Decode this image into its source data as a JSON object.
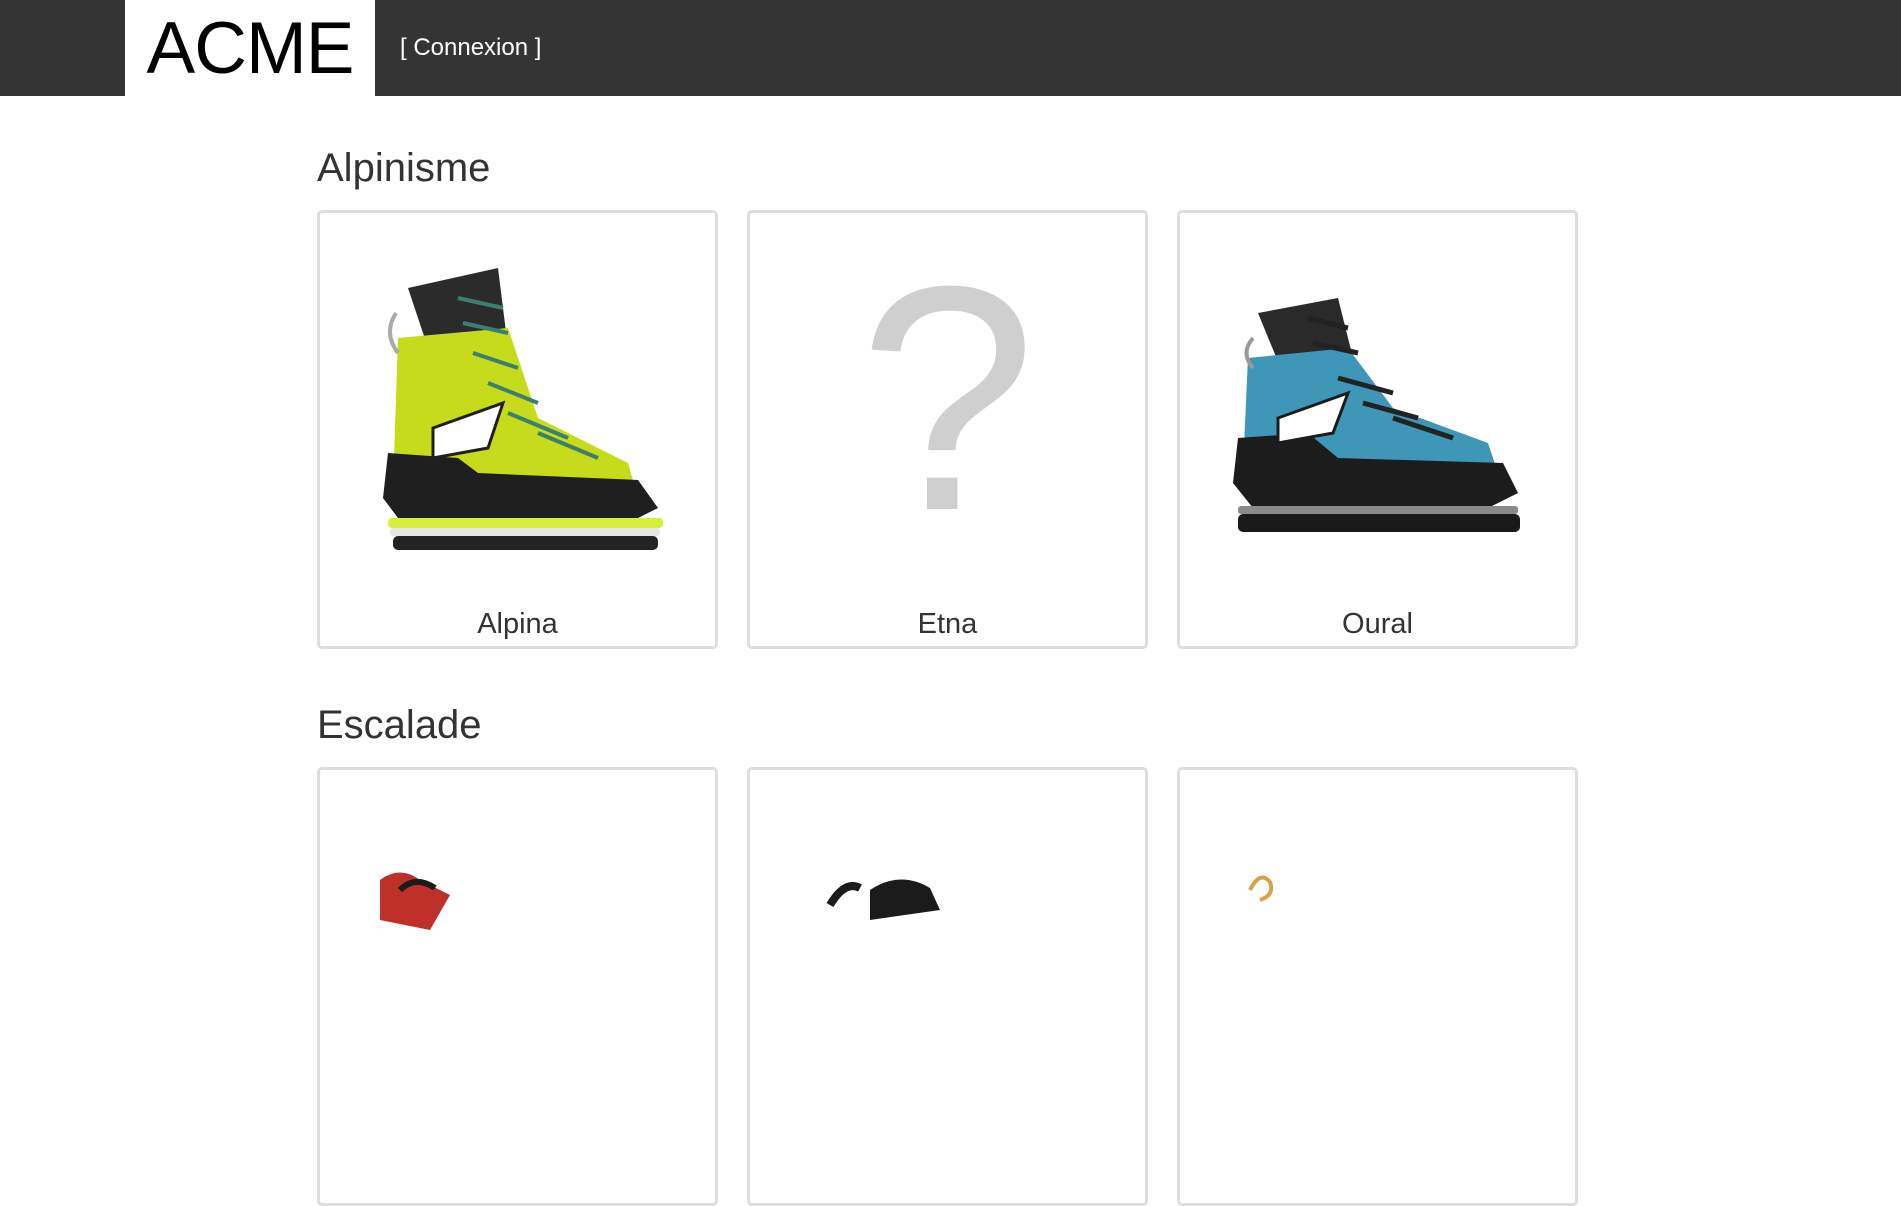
{
  "header": {
    "logo_text": "ACME",
    "login_label": "[ Connexion ]"
  },
  "sections": [
    {
      "title": "Alpinisme",
      "products": [
        {
          "name": "Alpina",
          "image": "lime-green-mountaineering-boot"
        },
        {
          "name": "Etna",
          "image": "question-mark-placeholder",
          "placeholder_glyph": "?"
        },
        {
          "name": "Oural",
          "image": "blue-black-mountaineering-boot"
        }
      ]
    },
    {
      "title": "Escalade",
      "products": [
        {
          "name": "",
          "image": "red-climbing-shoe"
        },
        {
          "name": "",
          "image": "black-climbing-shoe"
        },
        {
          "name": "",
          "image": "tan-climbing-shoe"
        }
      ]
    }
  ],
  "colors": {
    "header_bg": "#343434",
    "card_border": "#dedede",
    "placeholder": "#cfcfcf"
  }
}
